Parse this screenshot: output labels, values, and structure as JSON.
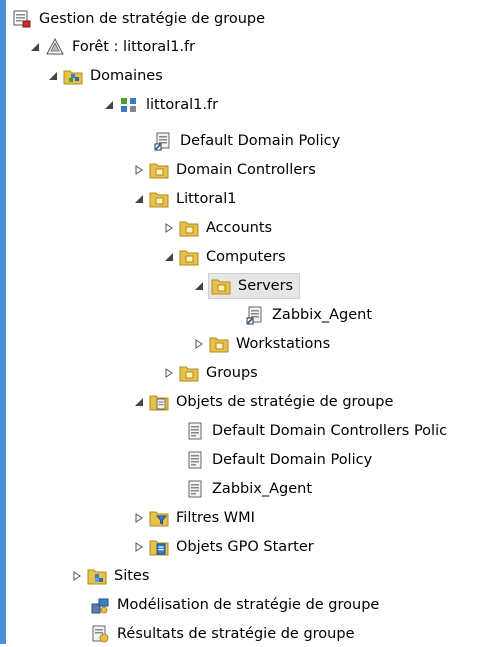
{
  "tree": {
    "root": "Gestion de stratégie de groupe",
    "forest": "Forêt : littoral1.fr",
    "domains": "Domaines",
    "domain": "littoral1.fr",
    "default_domain_policy_link": "Default Domain Policy",
    "domain_controllers": "Domain Controllers",
    "littoral1_ou": "Littoral1",
    "accounts": "Accounts",
    "computers": "Computers",
    "servers": "Servers",
    "zabbix_agent_link": "Zabbix_Agent",
    "workstations": "Workstations",
    "groups": "Groups",
    "gpo_objects": "Objets de stratégie de groupe",
    "gpo_default_dc": "Default Domain Controllers Polic",
    "gpo_default_domain": "Default Domain Policy",
    "gpo_zabbix": "Zabbix_Agent",
    "wmi_filters": "Filtres WMI",
    "starter_gpos": "Objets GPO Starter",
    "sites": "Sites",
    "modeling": "Modélisation de stratégie de groupe",
    "results": "Résultats de stratégie de groupe"
  },
  "colors": {
    "folder": "#e7c14a",
    "selection": "#e6e6e6",
    "frame": "#4a90d6"
  }
}
